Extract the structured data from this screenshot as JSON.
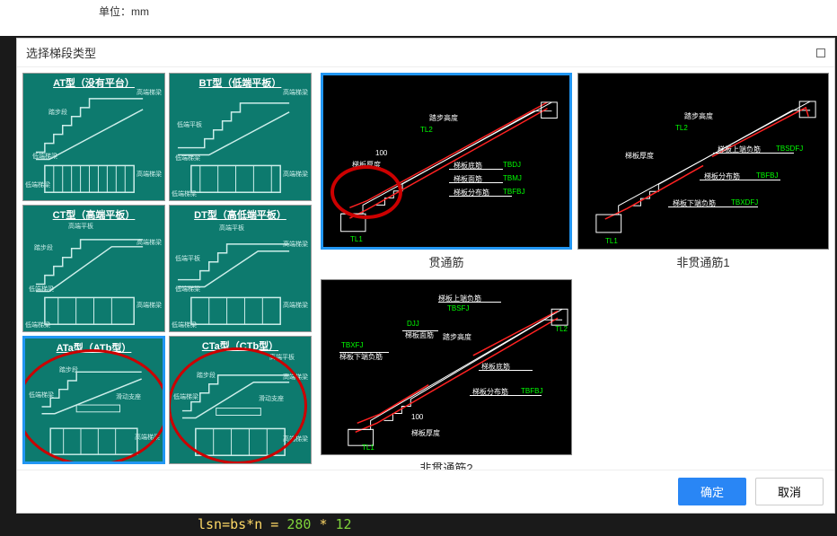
{
  "bg": {
    "unit_label": "单位：mm"
  },
  "dialog": {
    "title": "选择梯段类型"
  },
  "stair_types": [
    {
      "title": "AT型（没有平台）",
      "labels": [
        "高端梯梁",
        "踏步段",
        "低端梯梁",
        "低端梯梁",
        "高端梯梁"
      ]
    },
    {
      "title": "BT型（低端平板）",
      "labels": [
        "高端梯梁",
        "低端平板",
        "低端梯梁",
        "低端梯梁",
        "高端梯梁"
      ]
    },
    {
      "title": "CT型（高端平板）",
      "labels": [
        "高端平板",
        "踏步段",
        "高端梯梁",
        "低端梯梁",
        "低端梯梁",
        "高端梯梁"
      ]
    },
    {
      "title": "DT型（高低端平板）",
      "labels": [
        "高端平板",
        "低端平板",
        "高端梯梁",
        "低端梯梁",
        "低端梯梁",
        "高端梯梁"
      ]
    },
    {
      "title": "ATa型（ATb型）",
      "labels": [
        "踏步段",
        "低端梯梁",
        "滑动支座",
        "高端梯梁"
      ]
    },
    {
      "title": "CTa型（CTb型）",
      "labels": [
        "高端平板",
        "踏步段",
        "高端梯梁",
        "低端梯梁",
        "滑动支座",
        "高端梯梁"
      ]
    }
  ],
  "details": [
    {
      "label": "贯通筋",
      "annotations": [
        "踏步高度",
        "100",
        "梯板厚度",
        "梯板底筋",
        "梯板面筋",
        "梯板分布筋",
        "TL1",
        "TL2",
        "TBDJ",
        "TBMJ",
        "TBFBJ"
      ]
    },
    {
      "label": "非贯通筋1",
      "annotations": [
        "踏步高度",
        "梯板厚度",
        "梯板上端负筋",
        "梯板分布筋",
        "梯板下端负筋",
        "TL1",
        "TL2",
        "TBSDFJ",
        "TBFBJ",
        "TBXDFJ"
      ]
    },
    {
      "label": "非贯通筋2",
      "annotations": [
        "梯板上端负筋",
        "梯板面筋",
        "踏步高度",
        "梯板底筋",
        "梯板分布筋",
        "梯板下端负筋",
        "100",
        "梯板厚度",
        "TL1",
        "TL2",
        "TBSFJ",
        "DJJ",
        "TBFBJ",
        "TBXFJ"
      ]
    }
  ],
  "buttons": {
    "ok": "确定",
    "cancel": "取消"
  },
  "code_line": {
    "prefix": "lsn=bs*n = ",
    "v1": "280",
    "sep": " * ",
    "v2": "12"
  }
}
